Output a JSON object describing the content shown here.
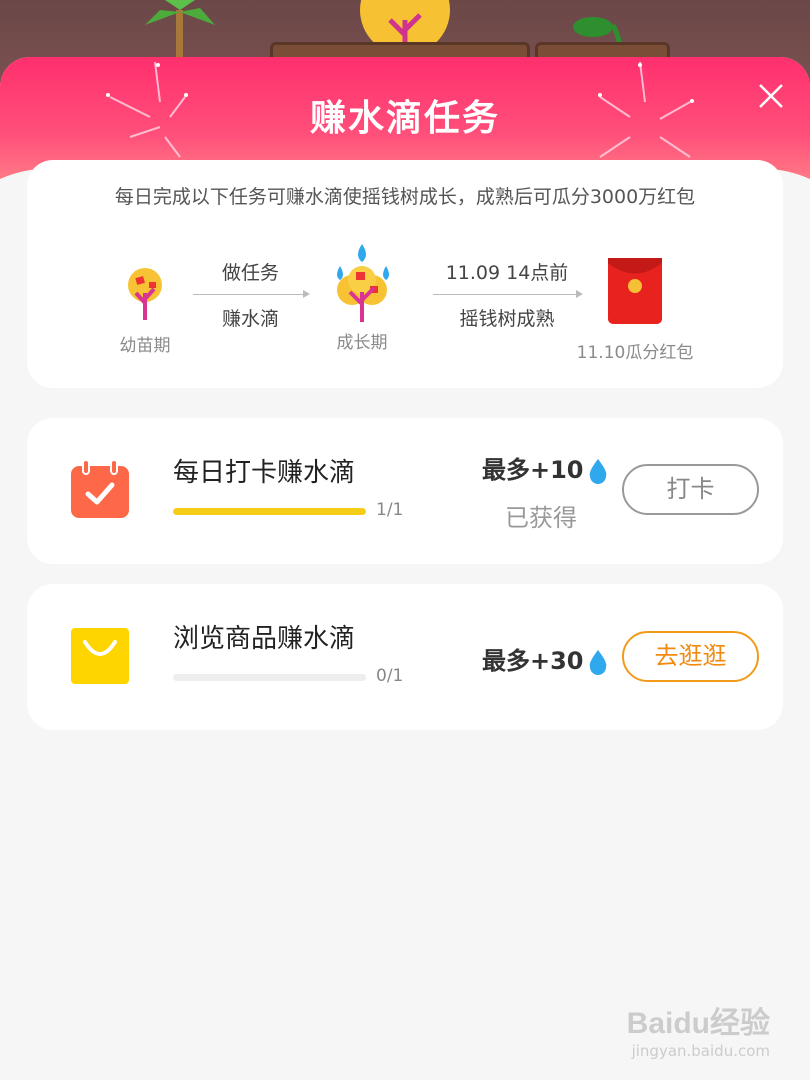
{
  "header": {
    "title": "赚水滴任务"
  },
  "intro": {
    "description": "每日完成以下任务可赚水滴使摇钱树成长，成熟后可瓜分3000万红包",
    "stages": [
      {
        "label": "幼苗期",
        "icon": "sapling-icon"
      },
      {
        "label": "成长期",
        "icon": "growing-tree-icon"
      },
      {
        "label": "11.10瓜分红包",
        "icon": "red-envelope-icon"
      }
    ],
    "arrows": [
      {
        "top": "做任务",
        "bottom": "赚水滴"
      },
      {
        "top": "11.09 14点前",
        "bottom": "摇钱树成熟"
      }
    ]
  },
  "tasks": [
    {
      "title": "每日打卡赚水滴",
      "progress_text": "1/1",
      "progress": 1.0,
      "reward": "最多+10",
      "status": "已获得",
      "button": "打卡",
      "icon": "calendar-check-icon"
    },
    {
      "title": "浏览商品赚水滴",
      "progress_text": "0/1",
      "progress": 0.0,
      "reward": "最多+30",
      "button": "去逛逛",
      "icon": "shopping-bag-icon"
    }
  ],
  "watermark": {
    "main": "Baidu经验",
    "sub": "jingyan.baidu.com"
  },
  "colors": {
    "header": "#ff2f6e",
    "progress": "#f5cc16",
    "accent_orange": "#f29b1b",
    "drop": "#2fa8ee"
  }
}
